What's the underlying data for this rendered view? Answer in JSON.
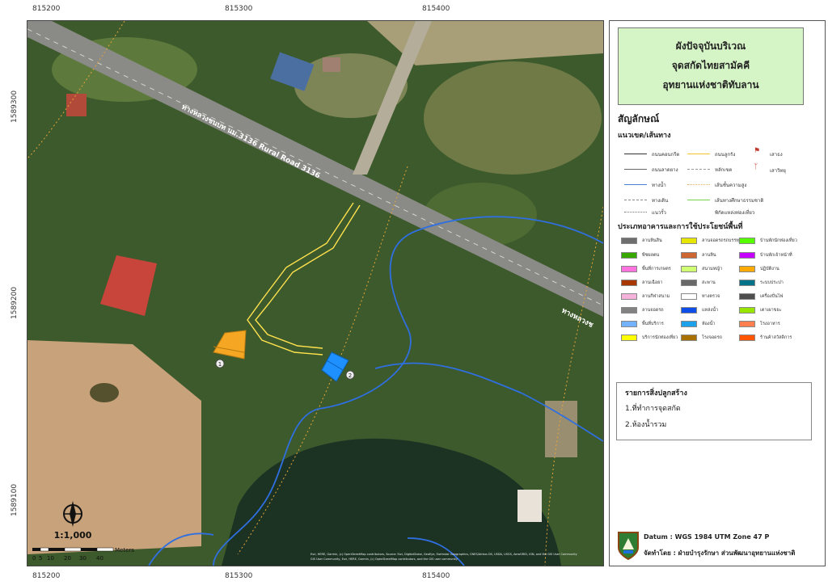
{
  "grid": {
    "x_labels": [
      "815200",
      "815300",
      "815400"
    ],
    "y_labels": [
      "1589300",
      "1589200",
      "1589100"
    ]
  },
  "map": {
    "road_label": "ทางหลวงชนบท นม.3136 Rural Road 3136",
    "road_label_right": "ทางหลวงช",
    "building_labels": [
      "1",
      "2"
    ],
    "scale_text": "1:1,000",
    "scale_bar": {
      "ticks": [
        "0",
        "5",
        "10",
        "20",
        "30",
        "40"
      ],
      "unit": "Meters"
    },
    "attribution": [
      "Esri, HERE, Garmin, (c) OpenStreetMap contributors, Source: Esri, DigitalGlobe, GeoEye, Earthstar Geographics, CNES/Airbus DS, USDA, USGS, AeroGRID, IGN, and the GIS User Community",
      "GIS User Community, Esri, HERE, Garmin, (c) OpenStreetMap contributors, and the GIS user community"
    ],
    "colors": {
      "orange_building": "#f5a623",
      "blue_building": "#1e90ff",
      "path": "#ffe14d",
      "water": "#2f6fe0"
    }
  },
  "legend": {
    "title_lines": [
      "ผังปัจจุบันบริเวณ",
      "จุดสกัดไทยสามัคคี",
      "อุทยานแห่งชาติทับลาน"
    ],
    "symbols_heading": "สัญลักษณ์",
    "lines_heading": "แนวเขต/เส้นทาง",
    "line_items_left": [
      {
        "label": "ถนนคอนกรีต",
        "color": "#333333"
      },
      {
        "label": "ถนนลาดยาง",
        "color": "#666666"
      },
      {
        "label": "ทางน้ำ",
        "color": "#4a7fd4"
      },
      {
        "label": "ทางเดิน",
        "color": "#888888"
      },
      {
        "label": "แนวรั้ว",
        "color": "#777777"
      }
    ],
    "line_items_right": [
      {
        "label": "ถนนลูกรัง",
        "color": "#f2c230"
      },
      {
        "label": "หลักเขต",
        "color": "#999999"
      },
      {
        "label": "เส้นชั้นความสูง",
        "color": "#e0b060"
      },
      {
        "label": "เส้นทางศึกษาธรรมชาติ",
        "color": "#77d04a"
      },
      {
        "label": "พิกัดแหล่งท่องเที่ยว",
        "color": "#555555"
      }
    ],
    "point_items": [
      {
        "label": "เสาธง",
        "icon": "flag-icon"
      },
      {
        "label": "เสาวิทยุ",
        "icon": "radio-tower-icon"
      }
    ],
    "landuse_heading": "ประเภทอาคารและการใช้ประโยชน์พื้นที่",
    "landuse_col1": [
      {
        "label": "ลานหินสิน",
        "color": "#6e6e6e"
      },
      {
        "label": "พืชผลตน",
        "color": "#38a800"
      },
      {
        "label": "พื้นที่การเกษตร",
        "color": "#ff73df"
      },
      {
        "label": "ลานเฉือยา",
        "color": "#a83800"
      },
      {
        "label": "ลานกีฬาสนาม",
        "color": "#f5b3dc"
      },
      {
        "label": "ลานจอดรถ",
        "color": "#828282"
      },
      {
        "label": "พื้นที่บริการ",
        "color": "#73b2ff"
      },
      {
        "label": "บริการนักท่องเที่ยว",
        "color": "#ffff00"
      }
    ],
    "landuse_col2": [
      {
        "label": "ลานจอดรถรถบรรทุก",
        "color": "#e6e600"
      },
      {
        "label": "ลานหิน",
        "color": "#cd6633"
      },
      {
        "label": "สนามหญ้า",
        "color": "#d1ff73"
      },
      {
        "label": "สะพาน",
        "color": "#686868"
      },
      {
        "label": "ทางตรวจ",
        "color": "#ffffff"
      },
      {
        "label": "แหล่งน้ำ",
        "color": "#0d4de8"
      },
      {
        "label": "ห้องน้ำ",
        "color": "#1ea1eb"
      },
      {
        "label": "โรงจอดรถ",
        "color": "#a87000"
      }
    ],
    "landuse_col3": [
      {
        "label": "บ้านพักนักท่องเที่ยว",
        "color": "#55ff00"
      },
      {
        "label": "บ้านพักเจ้าหน้าที่",
        "color": "#c500ff"
      },
      {
        "label": "ปฏิบัติงาน",
        "color": "#ffaa00"
      },
      {
        "label": "ระบบประปา",
        "color": "#00738a"
      },
      {
        "label": "เครื่องปั่นไฟ",
        "color": "#4e4e4e"
      },
      {
        "label": "เตาเผาขยะ",
        "color": "#98e600"
      },
      {
        "label": "โรงอาหาร",
        "color": "#ff7f50"
      },
      {
        "label": "ร้านค้าสวัสดิการ",
        "color": "#ff5500"
      }
    ],
    "buildings_title": "รายการสิ่งปลูกสร้าง",
    "buildings": [
      "1.ที่ทำการจุดสกัด",
      "2.ห้องน้ำรวม"
    ],
    "datum": "Datum : WGS 1984 UTM Zone 47 P",
    "made_by": "จัดทำโดย : ฝ่ายบำรุงรักษา ส่วนพัฒนาอุทยานแห่งชาติ"
  }
}
